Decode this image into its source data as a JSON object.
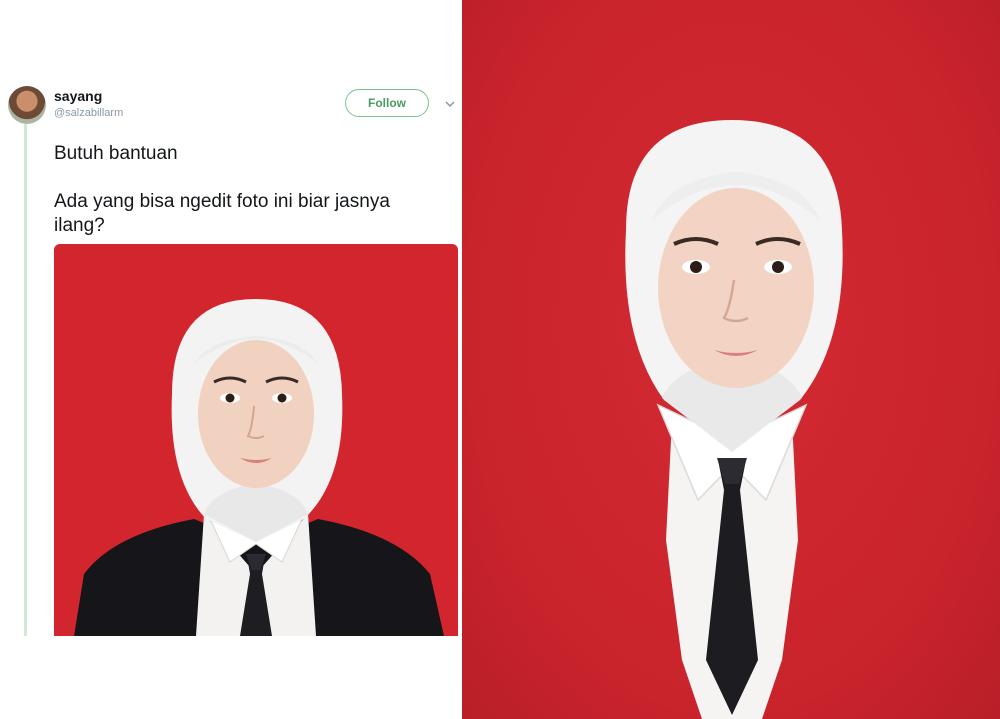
{
  "tweet": {
    "display_name": "sayang",
    "handle": "@salzabillarm",
    "follow_label": "Follow",
    "text_line_1": "Butuh bantuan",
    "text_line_2": "Ada yang bisa ngedit foto ini biar jasnya",
    "text_line_3": "ilang?"
  },
  "colors": {
    "background_red": "#d3252e",
    "follow_green": "#4a9b5f",
    "thread_line": "#cfe8d6"
  },
  "icons": {
    "caret": "chevron-down-icon",
    "avatar": "avatar"
  }
}
